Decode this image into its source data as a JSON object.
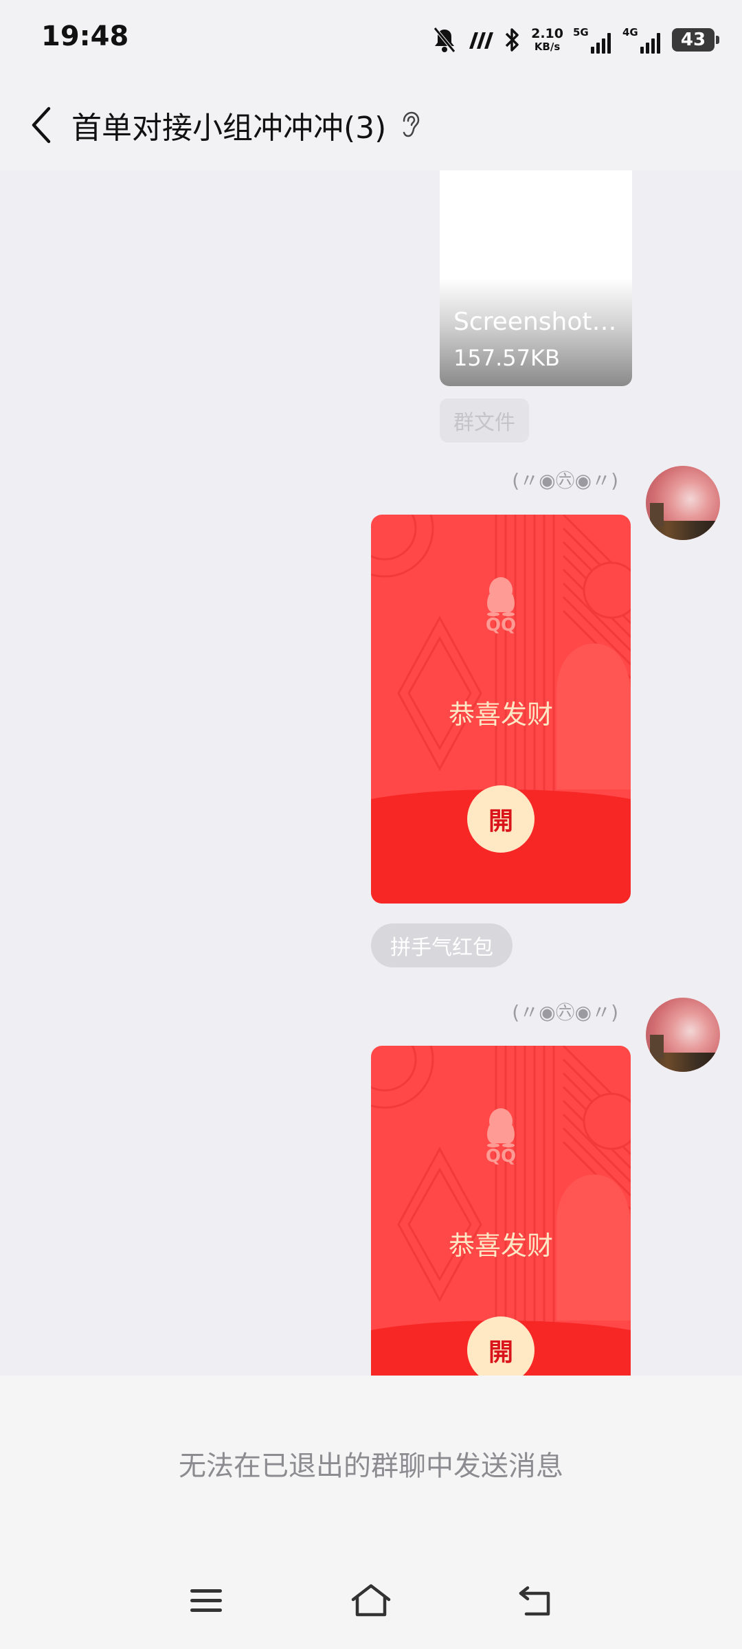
{
  "status_bar": {
    "time": "19:48",
    "net_speed": "2.10",
    "net_unit": "KB/s",
    "sim1_tag": "5G",
    "sim2_tag": "4G",
    "battery": "43"
  },
  "header": {
    "title": "首单对接小组冲冲冲(3)"
  },
  "messages": {
    "file": {
      "name": "Screenshot…",
      "size": "157.57KB",
      "tag": "群文件"
    },
    "packet1": {
      "nickname": "(〃◉㊅◉〃)",
      "qq_label": "QQ",
      "title": "恭喜发财",
      "open_label": "開",
      "type_label": "拼手气红包"
    },
    "packet2": {
      "nickname": "(〃◉㊅◉〃)",
      "qq_label": "QQ",
      "title": "恭喜发财",
      "open_label": "開"
    }
  },
  "notice": "无法在已退出的群聊中发送消息",
  "colors": {
    "packet_red": "#ff4847",
    "packet_dark_red": "#f72726",
    "open_button": "#ffe9c5"
  }
}
